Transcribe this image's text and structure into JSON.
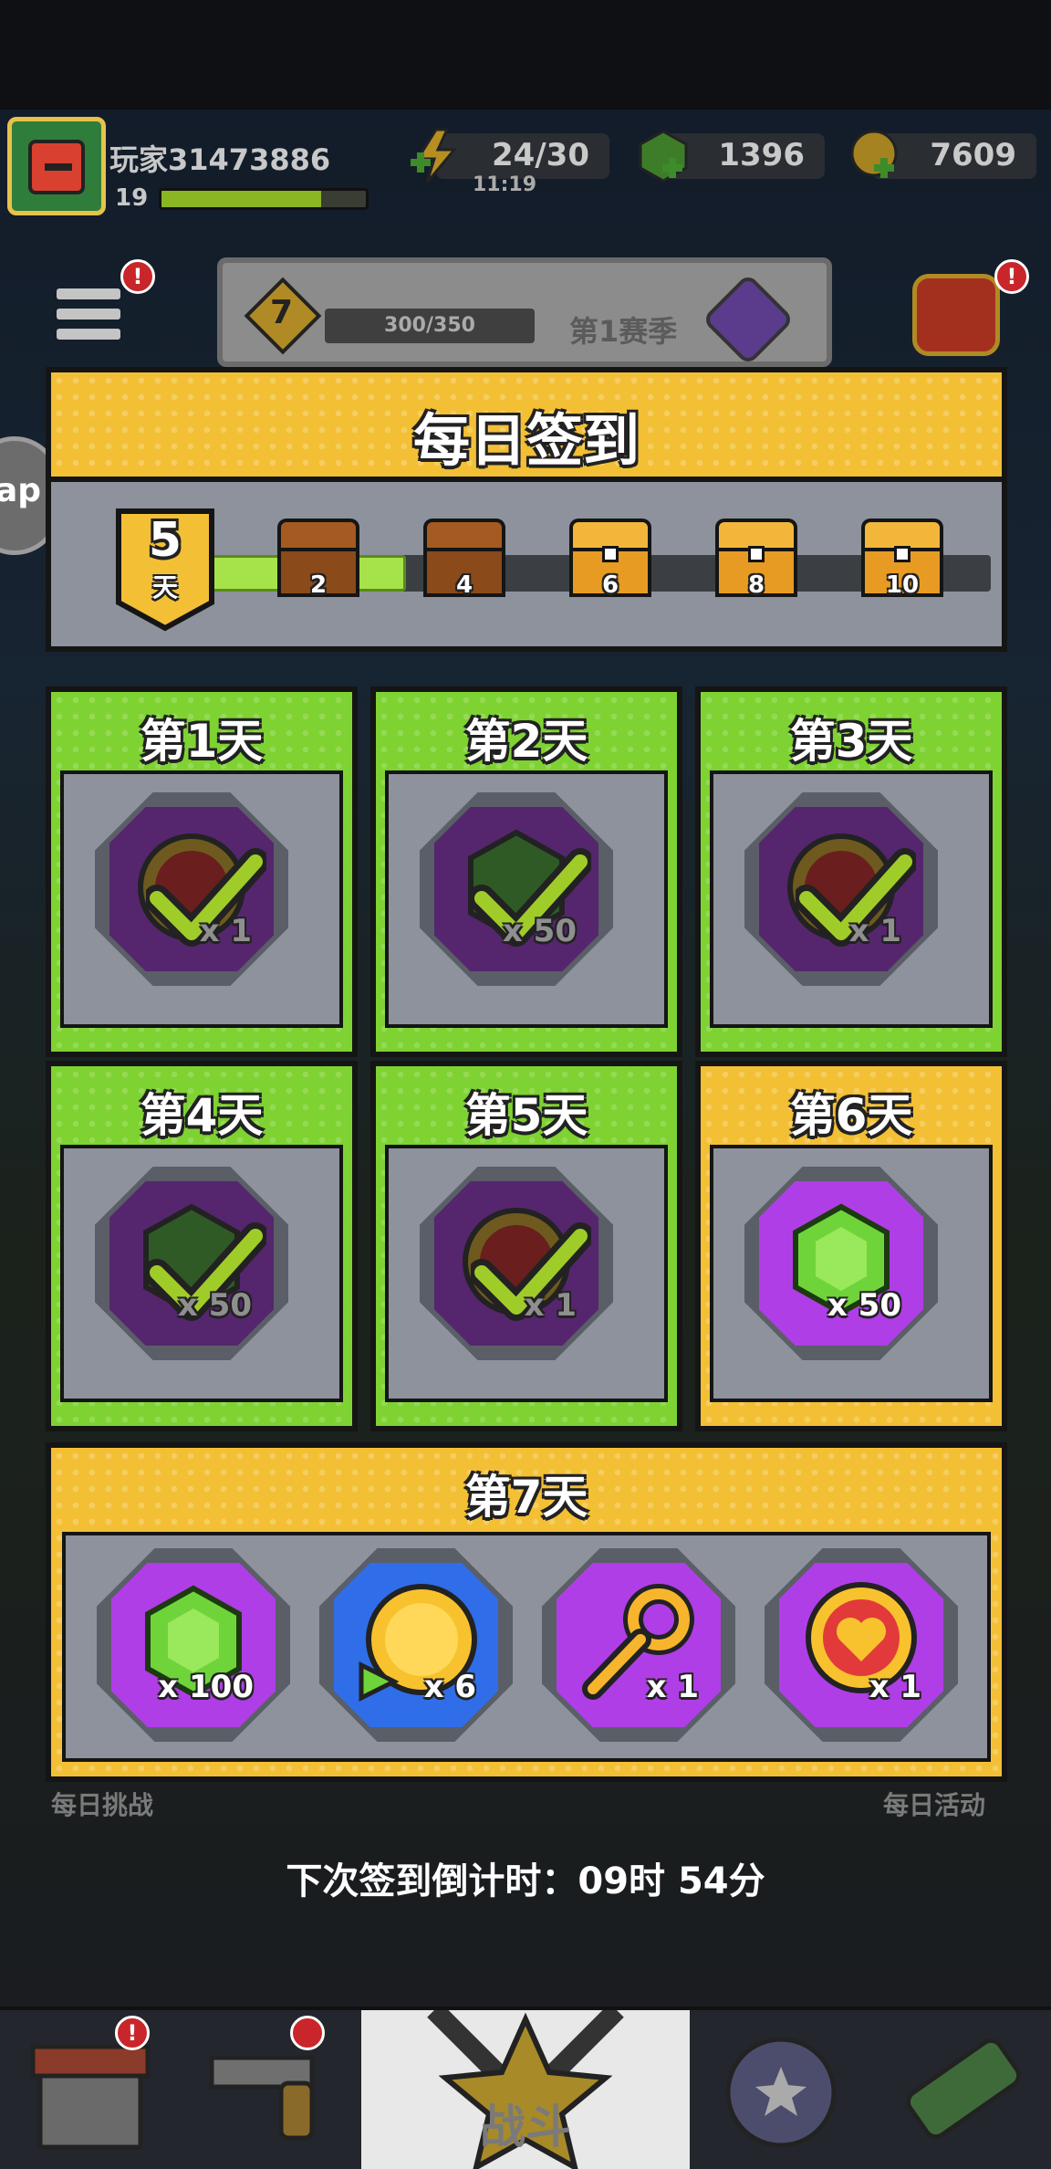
{
  "player": {
    "name": "玩家31473886",
    "level": "19",
    "xp_fraction": 0.78
  },
  "resources": {
    "energy": "24/30",
    "energy_timer": "11:19",
    "gems": "1396",
    "coins": "7609"
  },
  "background": {
    "season_level": "7",
    "season_progress": "300/350",
    "season_name": "第1赛季",
    "app_bubble_text": "ap",
    "daily_challenge": "每日挑战",
    "daily_event": "每日活动",
    "notification_mark": "!"
  },
  "modal": {
    "title": "每日签到",
    "streak": {
      "days": "5",
      "unit": "天",
      "progress_fraction": 0.255
    },
    "milestones": [
      {
        "days": "2",
        "opened": true
      },
      {
        "days": "4",
        "opened": true
      },
      {
        "days": "6",
        "opened": false
      },
      {
        "days": "8",
        "opened": false
      },
      {
        "days": "10",
        "opened": false
      }
    ],
    "days": [
      {
        "label": "第1天",
        "reward": "heart-coin",
        "qty": "x 1",
        "claimed": true
      },
      {
        "label": "第2天",
        "reward": "gem",
        "qty": "x 50",
        "claimed": true
      },
      {
        "label": "第3天",
        "reward": "heart-coin",
        "qty": "x 1",
        "claimed": true
      },
      {
        "label": "第4天",
        "reward": "gem",
        "qty": "x 50",
        "claimed": true
      },
      {
        "label": "第5天",
        "reward": "heart-coin",
        "qty": "x 1",
        "claimed": true
      },
      {
        "label": "第6天",
        "reward": "gem",
        "qty": "x 50",
        "claimed": false
      }
    ],
    "day7": {
      "label": "第7天",
      "rewards": [
        {
          "icon": "gem-icon",
          "qty": "x 100"
        },
        {
          "icon": "gold-coin-icon",
          "qty": "x 6"
        },
        {
          "icon": "key-icon",
          "qty": "x 1"
        },
        {
          "icon": "heart-coin-icon",
          "qty": "x 1"
        }
      ]
    },
    "countdown_label": "下次签到倒计时：",
    "countdown_value": "09时 54分"
  },
  "nav": {
    "battle": "战斗"
  },
  "colors": {
    "claimed_green": "#7ed232",
    "current_yellow": "#f3bf35",
    "panel_gray": "#8d929c",
    "tile_purple": "#b03ee6",
    "tile_blue": "#2f6ee8"
  }
}
